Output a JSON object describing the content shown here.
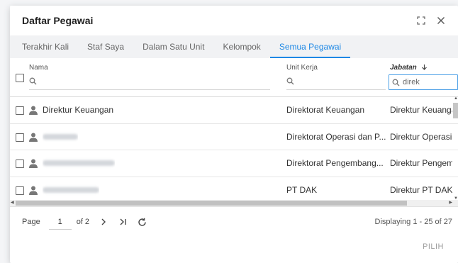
{
  "dialog": {
    "title": "Daftar Pegawai"
  },
  "tabs": [
    {
      "label": "Terakhir Kali"
    },
    {
      "label": "Staf Saya"
    },
    {
      "label": "Dalam Satu Unit"
    },
    {
      "label": "Kelompok"
    },
    {
      "label": "Semua Pegawai"
    }
  ],
  "grid": {
    "columns": {
      "nama": "Nama",
      "unit": "Unit Kerja",
      "jabatan": "Jabatan"
    },
    "filters": {
      "jabatan_value": "direk"
    },
    "rows": [
      {
        "nama": "Direktur Keuangan",
        "unit": "Direktorat Keuangan",
        "jabatan": "Direktur Keuanga"
      },
      {
        "nama": "",
        "unit": "Direktorat Operasi dan P...",
        "jabatan": "Direktur Operasi"
      },
      {
        "nama": "",
        "unit": "Direktorat Pengembang...",
        "jabatan": "Direktur Pengem"
      },
      {
        "nama": "",
        "unit": "PT DAK",
        "jabatan": "Direktur PT DAK"
      }
    ]
  },
  "pager": {
    "page_label": "Page",
    "current_page": "1",
    "of_pages": "of 2",
    "display_info": "Displaying 1 - 25 of 27"
  },
  "footer": {
    "pilih_label": "PILIH"
  }
}
